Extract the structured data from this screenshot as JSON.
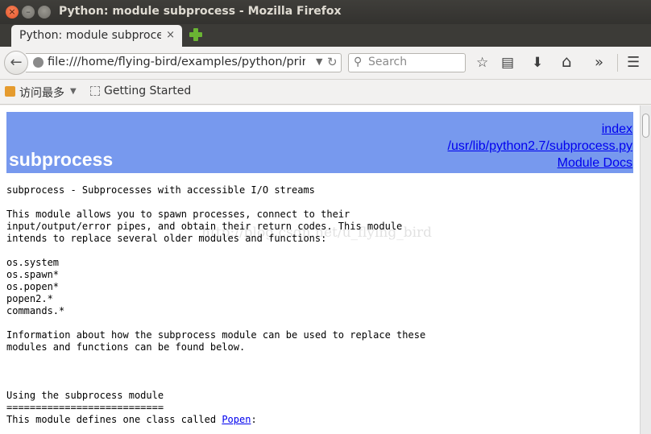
{
  "window": {
    "title": "Python: module subprocess - Mozilla Firefox",
    "close_glyph": "×",
    "min_glyph": "–",
    "max_glyph": ""
  },
  "tab": {
    "label": "Python: module subprocess",
    "close_glyph": "×"
  },
  "navbar": {
    "back_glyph": "←",
    "url": "file:///home/flying-bird/examples/python/print_",
    "url_dropdown_glyph": "▼",
    "reload_glyph": "↻",
    "search_placeholder": "Search",
    "search_glyph": "⚲",
    "icons": [
      {
        "name": "bookmark-star-icon",
        "glyph": "☆"
      },
      {
        "name": "reading-list-icon",
        "glyph": "▤"
      },
      {
        "name": "download-icon",
        "glyph": "⬇"
      },
      {
        "name": "home-icon",
        "glyph": "⌂"
      },
      {
        "name": "overflow-chevron-icon",
        "glyph": "»"
      },
      {
        "name": "menu-icon",
        "glyph": "☰"
      }
    ]
  },
  "bookmarks": {
    "most_visited": "访问最多",
    "dropdown_glyph": "▼",
    "getting_started": "Getting Started"
  },
  "page": {
    "title": "subprocess",
    "links": [
      "index",
      "/usr/lib/python2.7/subprocess.py",
      "Module Docs"
    ],
    "body_text": "subprocess - Subprocesses with accessible I/O streams\n\nThis module allows you to spawn processes, connect to their\ninput/output/error pipes, and obtain their return codes. This module\nintends to replace several older modules and functions:\n\nos.system\nos.spawn*\nos.popen*\npopen2.*\ncommands.*\n\nInformation about how the subprocess module can be used to replace these\nmodules and functions can be found below.\n\n\n\nUsing the subprocess module\n===========================\nThis module defines one class called ",
    "popen_link": "Popen",
    "popen_suffix": ":",
    "watermark": "http://blog.csdn.net/u_flying_bird"
  },
  "colors": {
    "heading_bg": "#7799ee",
    "link": "#0000ee"
  }
}
